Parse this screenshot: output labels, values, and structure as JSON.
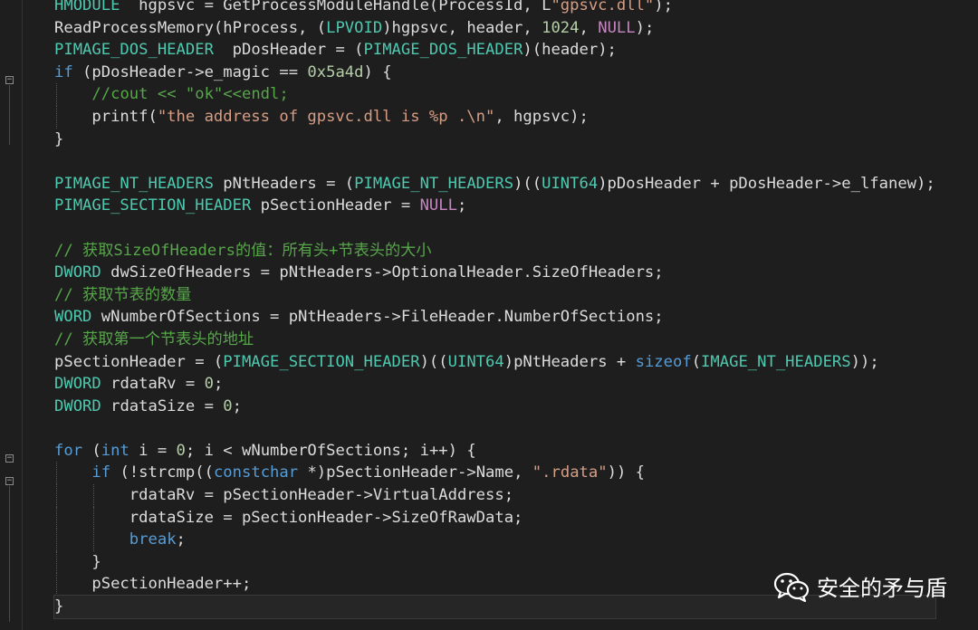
{
  "lines": [
    [
      [
        "tk-type",
        "HMODULE"
      ],
      [
        "",
        "  hgpsvc = GetProcessModuleHandle(ProcessId, L"
      ],
      [
        "tk-str",
        "\"gpsvc.dll\""
      ],
      [
        "",
        ");"
      ]
    ],
    [
      [
        "",
        "ReadProcessMemory(hProcess, ("
      ],
      [
        "tk-type",
        "LPVOID"
      ],
      [
        "",
        ")hgpsvc, header, "
      ],
      [
        "tk-num",
        "1024"
      ],
      [
        "",
        ", "
      ],
      [
        "tk-mac",
        "NULL"
      ],
      [
        "",
        ");"
      ]
    ],
    [
      [
        "tk-type",
        "PIMAGE_DOS_HEADER"
      ],
      [
        "",
        "  pDosHeader = ("
      ],
      [
        "tk-type",
        "PIMAGE_DOS_HEADER"
      ],
      [
        "",
        ")(header);"
      ]
    ],
    [
      [
        "tk-kw",
        "if"
      ],
      [
        "",
        " (pDosHeader->e_magic == "
      ],
      [
        "tk-num",
        "0x5a4d"
      ],
      [
        "",
        ") {"
      ]
    ],
    [
      [
        "",
        "    "
      ],
      [
        "tk-cm",
        "//cout << \"ok\"<<endl;"
      ]
    ],
    [
      [
        "",
        "    printf("
      ],
      [
        "tk-str",
        "\"the address of gpsvc.dll is %p .\\n\""
      ],
      [
        "",
        ", hgpsvc);"
      ]
    ],
    [
      [
        "",
        "}"
      ]
    ],
    [
      [
        "",
        ""
      ]
    ],
    [
      [
        "tk-type",
        "PIMAGE_NT_HEADERS"
      ],
      [
        "",
        " pNtHeaders = ("
      ],
      [
        "tk-type",
        "PIMAGE_NT_HEADERS"
      ],
      [
        "",
        ")(("
      ],
      [
        "tk-type",
        "UINT64"
      ],
      [
        "",
        ")pDosHeader + pDosHeader->e_lfanew);"
      ]
    ],
    [
      [
        "tk-type",
        "PIMAGE_SECTION_HEADER"
      ],
      [
        "",
        " pSectionHeader = "
      ],
      [
        "tk-mac",
        "NULL"
      ],
      [
        "",
        ";"
      ]
    ],
    [
      [
        "",
        ""
      ]
    ],
    [
      [
        "tk-cm",
        "// 获取SizeOfHeaders的值：所有头+节表头的大小"
      ]
    ],
    [
      [
        "tk-type",
        "DWORD"
      ],
      [
        "",
        " dwSizeOfHeaders = pNtHeaders->OptionalHeader.SizeOfHeaders;"
      ]
    ],
    [
      [
        "tk-cm",
        "// 获取节表的数量"
      ]
    ],
    [
      [
        "tk-type",
        "WORD"
      ],
      [
        "",
        " wNumberOfSections = pNtHeaders->FileHeader.NumberOfSections;"
      ]
    ],
    [
      [
        "tk-cm",
        "// 获取第一个节表头的地址"
      ]
    ],
    [
      [
        "",
        "pSectionHeader = ("
      ],
      [
        "tk-type",
        "PIMAGE_SECTION_HEADER"
      ],
      [
        "",
        ")(("
      ],
      [
        "tk-type",
        "UINT64"
      ],
      [
        "",
        ")pNtHeaders + "
      ],
      [
        "tk-kw",
        "sizeof"
      ],
      [
        "",
        "("
      ],
      [
        "tk-type",
        "IMAGE_NT_HEADERS"
      ],
      [
        "",
        "));"
      ]
    ],
    [
      [
        "tk-type",
        "DWORD"
      ],
      [
        "",
        " rdataRv = "
      ],
      [
        "tk-num",
        "0"
      ],
      [
        "",
        ";"
      ]
    ],
    [
      [
        "tk-type",
        "DWORD"
      ],
      [
        "",
        " rdataSize = "
      ],
      [
        "tk-num",
        "0"
      ],
      [
        "",
        ";"
      ]
    ],
    [
      [
        "",
        ""
      ]
    ],
    [
      [
        "tk-kw",
        "for"
      ],
      [
        "",
        " ("
      ],
      [
        "tk-kw",
        "int"
      ],
      [
        "",
        " i = "
      ],
      [
        "tk-num",
        "0"
      ],
      [
        "",
        "; i < wNumberOfSections; i++) {"
      ]
    ],
    [
      [
        "",
        "    "
      ],
      [
        "tk-kw",
        "if"
      ],
      [
        "",
        " (!strcmp(("
      ],
      [
        "tk-kw",
        "const"
      ],
      [
        "",
        "",
        " "
      ],
      [
        "tk-kw",
        "char"
      ],
      [
        "",
        " *)pSectionHeader->Name, "
      ],
      [
        "tk-str",
        "\".rdata\""
      ],
      [
        "",
        ")) {"
      ]
    ],
    [
      [
        "",
        "        rdataRv = pSectionHeader->VirtualAddress;"
      ]
    ],
    [
      [
        "",
        "        rdataSize = pSectionHeader->SizeOfRawData;"
      ]
    ],
    [
      [
        "",
        "        "
      ],
      [
        "tk-kw",
        "break"
      ],
      [
        "",
        ";"
      ]
    ],
    [
      [
        "",
        "    }"
      ]
    ],
    [
      [
        "",
        "    pSectionHeader++;"
      ]
    ],
    [
      [
        "",
        "}"
      ]
    ]
  ],
  "watermark": {
    "text": "安全的矛与盾",
    "icon": "wechat-icon"
  },
  "colors": {
    "background": "#1e1e1e",
    "type": "#4ec9b0",
    "keyword": "#569cd6",
    "string": "#d69d85",
    "number": "#b5cea8",
    "macro": "#c586c0",
    "comment": "#57a64a"
  }
}
